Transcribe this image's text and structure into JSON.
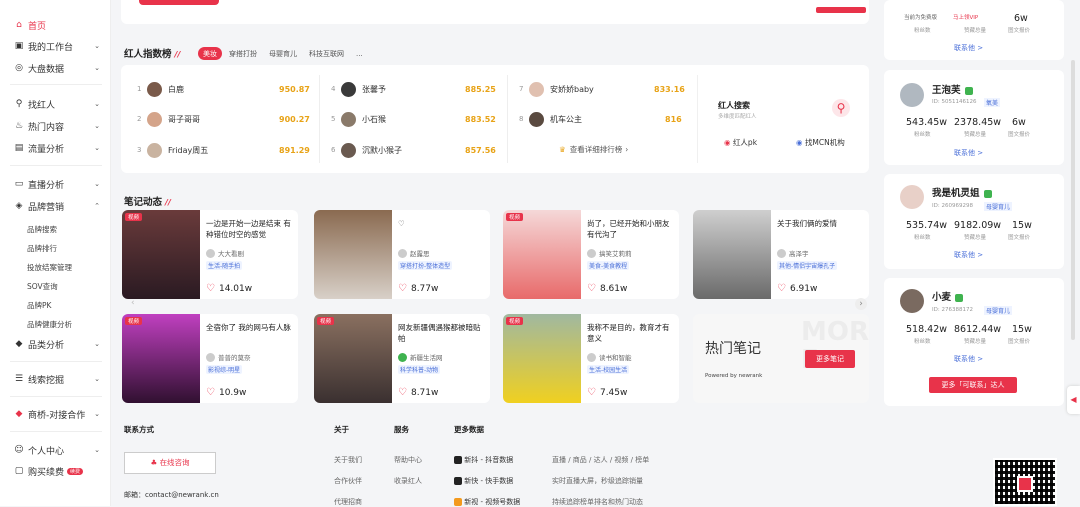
{
  "sidebar": {
    "items": [
      {
        "label": "首页",
        "icon": "home-icon"
      },
      {
        "label": "我的工作台",
        "icon": "workbench-icon"
      },
      {
        "label": "大盘数据",
        "icon": "dashboard-icon"
      },
      {
        "label": "找红人",
        "icon": "search-icon"
      },
      {
        "label": "热门内容",
        "icon": "flame-icon"
      },
      {
        "label": "流量分析",
        "icon": "chart-icon"
      },
      {
        "label": "直播分析",
        "icon": "live-icon"
      },
      {
        "label": "品牌营销",
        "icon": "brand-icon"
      },
      {
        "label": "品类分析",
        "icon": "category-icon"
      },
      {
        "label": "线索挖掘",
        "icon": "lead-icon"
      },
      {
        "label": "商桥-对接合作",
        "icon": "bridge-icon"
      },
      {
        "label": "个人中心",
        "icon": "user-icon"
      },
      {
        "label": "购买续费",
        "icon": "cart-icon"
      }
    ],
    "sub_items": [
      "品牌搜索",
      "品牌排行",
      "投放结案管理",
      "SOV查询",
      "品牌PK",
      "品牌健康分析"
    ],
    "renew_badge": "续费"
  },
  "ranking": {
    "title": "红人指数榜",
    "tabs": [
      "美妆",
      "穿搭打扮",
      "母婴育儿",
      "科技互联网",
      "..."
    ],
    "rows": [
      {
        "n": "1",
        "name": "白鹿",
        "score": "950.87"
      },
      {
        "n": "2",
        "name": "哥子哥哥",
        "score": "900.27"
      },
      {
        "n": "3",
        "name": "Friday周五",
        "score": "891.29"
      },
      {
        "n": "4",
        "name": "张馨予",
        "score": "885.25"
      },
      {
        "n": "5",
        "name": "小石猴",
        "score": "883.52"
      },
      {
        "n": "6",
        "name": "沉默小猴子",
        "score": "857.56"
      },
      {
        "n": "7",
        "name": "安娇娇baby",
        "score": "833.16"
      },
      {
        "n": "8",
        "name": "机车公主",
        "score": "816"
      }
    ],
    "more": "查看详细排行榜",
    "search_title": "红人搜索",
    "search_sub": "多维度匹配红人",
    "pk_label": "红人pk",
    "mcn_label": "找MCN机构"
  },
  "notes": {
    "title": "笔记动态",
    "items": [
      {
        "tag": "视频",
        "title": "一边是开始一边是结束 有种错位时空的感觉",
        "author": "大大看剧",
        "cat": "生活-随手拍",
        "likes": "14.01w"
      },
      {
        "tag": "",
        "title": "",
        "author": "赵露思",
        "cat": "穿搭打扮-整体造型",
        "likes": "8.77w"
      },
      {
        "tag": "视频",
        "title": "尚了，已经开始和小朋友有代沟了",
        "author": "搞笑艾莉莉",
        "cat": "美食-美食教程",
        "likes": "8.61w"
      },
      {
        "tag": "",
        "title": "关于我们俩的爱情",
        "author": "高泽宇",
        "cat": "其他-情侣宇宙爆孔子",
        "likes": "6.91w"
      },
      {
        "tag": "视频",
        "title": "全宿你了 我的网马有人脉",
        "author": "普普的莫奈",
        "cat": "影视综-明星",
        "likes": "10.9w"
      },
      {
        "tag": "视频",
        "title": "网友新疆偶遇猴都被暗贴帕",
        "author": "新疆生活网",
        "cat": "科学科普-动物",
        "likes": "8.71w"
      },
      {
        "tag": "视频",
        "title": "我称不是目的，教育才有意义",
        "author": "读书和智能",
        "cat": "生活-校园生活",
        "likes": "7.45w"
      }
    ],
    "hot_title": "热门笔记",
    "hot_sub": "Powered by newrank",
    "hot_btn": "更多笔记",
    "hot_watermark": "MORE"
  },
  "footer": {
    "contact_h": "联系方式",
    "consult_btn": "在线咨询",
    "email": "邮箱：contact@newrank.cn",
    "about_h": "关于",
    "about_items": [
      "关于我们",
      "合作伙伴",
      "代理招商"
    ],
    "service_h": "服务",
    "service_items": [
      "帮助中心",
      "收录红人"
    ],
    "more_h": "更多数据",
    "more_items": [
      "新抖 - 抖音数据",
      "新快 - 快手数据",
      "新视 - 视频号数据"
    ],
    "more_desc": [
      "直播 / 商品 / 达人 / 视频 / 榜单",
      "实时直播大屏，秒级追踪销量",
      "持续追踪榜单排名和热门动态"
    ]
  },
  "right": {
    "top_stat": "6w",
    "top_stat_label": "图文报价",
    "top_vip": "马上领VIP",
    "top_note": "当前为免费版",
    "top_labels": [
      "粉丝数",
      "赞藏总量"
    ],
    "kols": [
      {
        "name": "王泡芙",
        "id": "ID: 5051146126",
        "cate": "氧美",
        "fans": "543.45w",
        "likes": "2378.45w",
        "price": "6w"
      },
      {
        "name": "我是机灵姐",
        "id": "ID: 260969298",
        "cate": "母婴育儿",
        "fans": "535.74w",
        "likes": "9182.09w",
        "price": "15w"
      },
      {
        "name": "小麦",
        "id": "ID: 276388172",
        "cate": "母婴育儿",
        "fans": "518.42w",
        "likes": "8612.44w",
        "price": "15w"
      }
    ],
    "labels": [
      "粉丝数",
      "赞藏总量",
      "图文报价"
    ],
    "contact": "联系他 >",
    "more_btn": "更多「可联系」达人"
  },
  "colors": {
    "accent": "#e8334a",
    "gold": "#e8a317",
    "link": "#4a6fd8"
  }
}
